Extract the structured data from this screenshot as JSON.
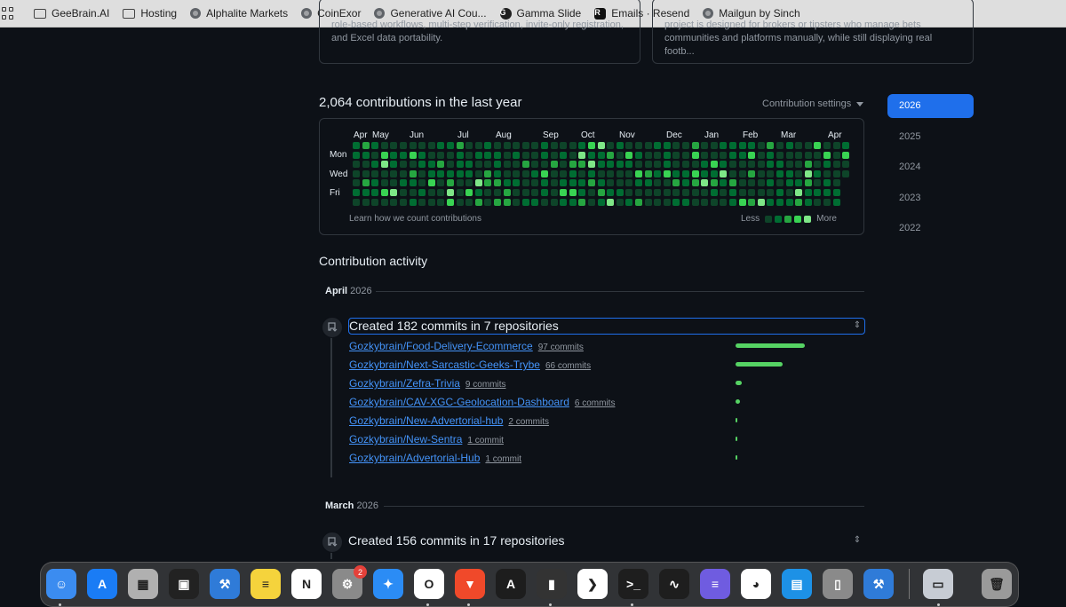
{
  "bookmarks": [
    {
      "label": "GeeBrain.AI",
      "icon": "folder-icon"
    },
    {
      "label": "Hosting",
      "icon": "folder-icon"
    },
    {
      "label": "Alphalite Markets",
      "icon": "globe-icon"
    },
    {
      "label": "CoinExor",
      "icon": "globe-icon"
    },
    {
      "label": "Generative AI Cou...",
      "icon": "globe-icon"
    },
    {
      "label": "Gamma Slide",
      "icon": "gamma-icon"
    },
    {
      "label": "Emails · Resend",
      "icon": "resend-icon"
    },
    {
      "label": "Mailgun by Sinch",
      "icon": "globe-icon"
    }
  ],
  "cards": {
    "left_lines": [
      "role-based workflows, multi-step verification, invite-only registration,",
      "and Excel data portability."
    ],
    "right_lines": [
      "project is designed for brokers or tipsters who manage bets",
      "communities and platforms manually, while still displaying real footb..."
    ]
  },
  "contributions": {
    "title": "2,064 contributions in the last year",
    "settings_label": "Contribution settings",
    "months": [
      "Apr",
      "May",
      "Jun",
      "Jul",
      "Aug",
      "Sep",
      "Oct",
      "Nov",
      "Dec",
      "Jan",
      "Feb",
      "Mar",
      "Apr"
    ],
    "day_labels": [
      "Mon",
      "Wed",
      "Fri"
    ],
    "learn_link": "Learn how we count contributions",
    "legend_less": "Less",
    "legend_more": "More",
    "levels": [
      "#0e4429",
      "#006d32",
      "#26a641",
      "#39d353",
      "#7ee787"
    ]
  },
  "years": [
    "2026",
    "2025",
    "2024",
    "2023",
    "2022"
  ],
  "activity": {
    "title": "Contribution activity",
    "sections": [
      {
        "month": "April",
        "year": "2026",
        "summary": "Created 182 commits in 7 repositories",
        "repos": [
          {
            "name": "Gozkybrain/Food-Delivery-Ecommerce",
            "count": "97 commits",
            "value": 97
          },
          {
            "name": "Gozkybrain/Next-Sarcastic-Geeks-Trybe",
            "count": "66 commits",
            "value": 66
          },
          {
            "name": "Gozkybrain/Zefra-Trivia",
            "count": "9 commits",
            "value": 9
          },
          {
            "name": "Gozkybrain/CAV-XGC-Geolocation-Dashboard",
            "count": "6 commits",
            "value": 6
          },
          {
            "name": "Gozkybrain/New-Advertorial-hub",
            "count": "2 commits",
            "value": 2
          },
          {
            "name": "Gozkybrain/New-Sentra",
            "count": "1 commit",
            "value": 1
          },
          {
            "name": "Gozkybrain/Advertorial-Hub",
            "count": "1 commit",
            "value": 1
          }
        ]
      },
      {
        "month": "March",
        "year": "2026",
        "summary": "Created 156 commits in 17 repositories",
        "repos": []
      }
    ]
  },
  "dock": {
    "apps": [
      {
        "name": "finder-icon",
        "color": "#3b8cf0",
        "glyph": "☺"
      },
      {
        "name": "app-store-icon",
        "color": "#1a7cf5",
        "glyph": "A"
      },
      {
        "name": "launchpad-icon",
        "color": "#b0b0b0",
        "glyph": "▦"
      },
      {
        "name": "mosaic-icon",
        "color": "#222222",
        "glyph": "▣"
      },
      {
        "name": "xcode-icon",
        "color": "#2f7bd8",
        "glyph": "⚒"
      },
      {
        "name": "notes-icon",
        "color": "#f5d33c",
        "glyph": "≡"
      },
      {
        "name": "notion-icon",
        "color": "#ffffff",
        "glyph": "N"
      },
      {
        "name": "system-settings-icon",
        "color": "#8a8a8a",
        "glyph": "⚙"
      },
      {
        "name": "safari-icon",
        "color": "#2b8cf5",
        "glyph": "✦"
      },
      {
        "name": "opera-icon",
        "color": "#ffffff",
        "glyph": "O"
      },
      {
        "name": "brave-icon",
        "color": "#f0492a",
        "glyph": "▼"
      },
      {
        "name": "arc-icon",
        "color": "#1d1d1d",
        "glyph": "A"
      },
      {
        "name": "dark-app-icon",
        "color": "#333333",
        "glyph": "▮"
      },
      {
        "name": "vscode-icon",
        "color": "#ffffff",
        "glyph": "❯"
      },
      {
        "name": "terminal-icon",
        "color": "#1e1e1e",
        "glyph": ">_"
      },
      {
        "name": "activity-monitor-icon",
        "color": "#1e1e1e",
        "glyph": "∿"
      },
      {
        "name": "linear-icon",
        "color": "#6f5ce0",
        "glyph": "≡"
      },
      {
        "name": "ollama-icon",
        "color": "#ffffff",
        "glyph": "◕"
      },
      {
        "name": "docker-icon",
        "color": "#1d91e6",
        "glyph": "▤"
      },
      {
        "name": "iphone-mirroring-icon",
        "color": "#8a8a8a",
        "glyph": "▯"
      },
      {
        "name": "xcode-instruments-icon",
        "color": "#2f7bd8",
        "glyph": "⚒"
      },
      {
        "name": "preview-icon",
        "color": "#c7ccd4",
        "glyph": "▭"
      },
      {
        "name": "trash-icon",
        "color": "#9a9a9a",
        "glyph": "🗑"
      }
    ],
    "settings_badge": "2"
  }
}
